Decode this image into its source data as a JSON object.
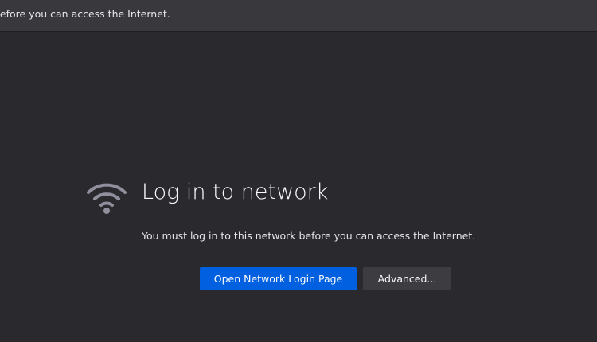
{
  "notification": {
    "text": "before you can access the Internet."
  },
  "page": {
    "icon": "wifi-icon",
    "title": "Log in to network",
    "description": "You must log in to this network before you can access the Internet.",
    "primary_button": "Open Network Login Page",
    "secondary_button": "Advanced..."
  },
  "colors": {
    "accent": "#0060df",
    "background": "#2a2a2e"
  }
}
